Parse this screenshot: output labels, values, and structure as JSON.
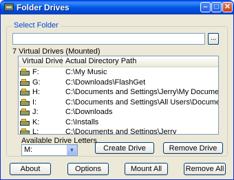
{
  "window": {
    "title": "Folder Drives"
  },
  "select_folder": {
    "group_label": "Select Folder",
    "path_value": "",
    "browse_label": "..."
  },
  "drives_list": {
    "count_label": "7 Virtual Drives (Mounted)",
    "columns": [
      "Virtual Drive",
      "Actual Directory Path"
    ],
    "rows": [
      {
        "drive": "F:",
        "path": "C:\\My Music"
      },
      {
        "drive": "G:",
        "path": "C:\\Downloads\\FlashGet"
      },
      {
        "drive": "H:",
        "path": "C:\\Documents and Settings\\Jerry\\My Documents"
      },
      {
        "drive": "I:",
        "path": "C:\\Documents and Settings\\All Users\\Documents"
      },
      {
        "drive": "J:",
        "path": "C:\\Downloads"
      },
      {
        "drive": "K:",
        "path": "C:\\Installs"
      },
      {
        "drive": "L:",
        "path": "C:\\Documents and Settings\\Jerry"
      }
    ]
  },
  "available": {
    "label": "Available Drive Letters",
    "selected": "M:"
  },
  "buttons": {
    "create_drive": "Create Drive",
    "remove_drive": "Remove Drive",
    "about": "About",
    "options": "Options",
    "mount_all": "Mount All",
    "remove_all": "Remove All"
  },
  "icons": {
    "app": "folder-drives-icon",
    "drive": "drive-icon",
    "minimize": "minimize-icon",
    "maximize": "maximize-icon",
    "close": "close-icon",
    "dropdown": "chevron-down-icon"
  },
  "colors": {
    "titlebar": "#0058e6",
    "window_bg": "#ece9d8",
    "group_label": "#0046d5",
    "close_button": "#c3411a"
  }
}
